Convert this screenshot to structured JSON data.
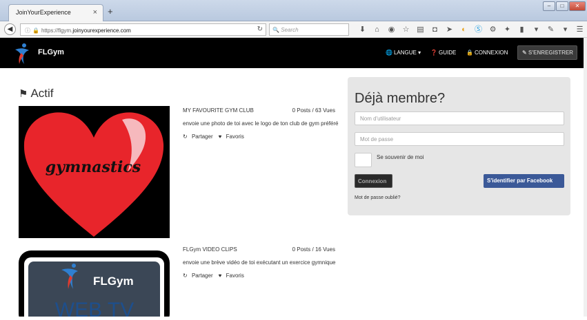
{
  "browser": {
    "tab_title": "JoinYourExperience",
    "tab_close": "×",
    "new_tab": "+",
    "win_minimize": "–",
    "win_maximize": "□",
    "win_close": "✕",
    "url_prefix": "https://flgym.",
    "url_domain": "joinyourexperience.com",
    "search_placeholder": "Search"
  },
  "header": {
    "logo_text": "FLGym",
    "menu": {
      "language": "LANGUE",
      "guide": "GUIDE",
      "login": "CONNEXION",
      "register": "S'ENREGISTRER"
    }
  },
  "section": {
    "title": "Actif"
  },
  "items": [
    {
      "name": "MY FAVOURITE GYM CLUB",
      "stats": "0 Posts / 63 Vues",
      "description": "envoie une photo de toi avec le logo de ton club de gym préféré",
      "share": "Partager",
      "favorite": "Favoris",
      "image_text": "gymnastics"
    },
    {
      "name": "FLGym VIDEO CLIPS",
      "stats": "0 Posts / 16 Vues",
      "description": "envoie une brève vidéo de toi exécutant un exercice gymnique",
      "share": "Partager",
      "favorite": "Favoris",
      "image_logo": "FLGym",
      "image_text": "WEB TV"
    }
  ],
  "login": {
    "title": "Déjà membre?",
    "username_placeholder": "Nom d'utilisateur",
    "password_placeholder": "Mot de passe",
    "remember_label": "Se souvenir de moi",
    "connect_label": "Connexion",
    "facebook_label": "S'identifier par Facebook",
    "forgot_label": "Mot de passe oublié?"
  },
  "colors": {
    "header_bg": "#000000",
    "heart_red": "#e8252b",
    "facebook_blue": "#3b5998",
    "panel_bg": "#e6e6e6"
  }
}
